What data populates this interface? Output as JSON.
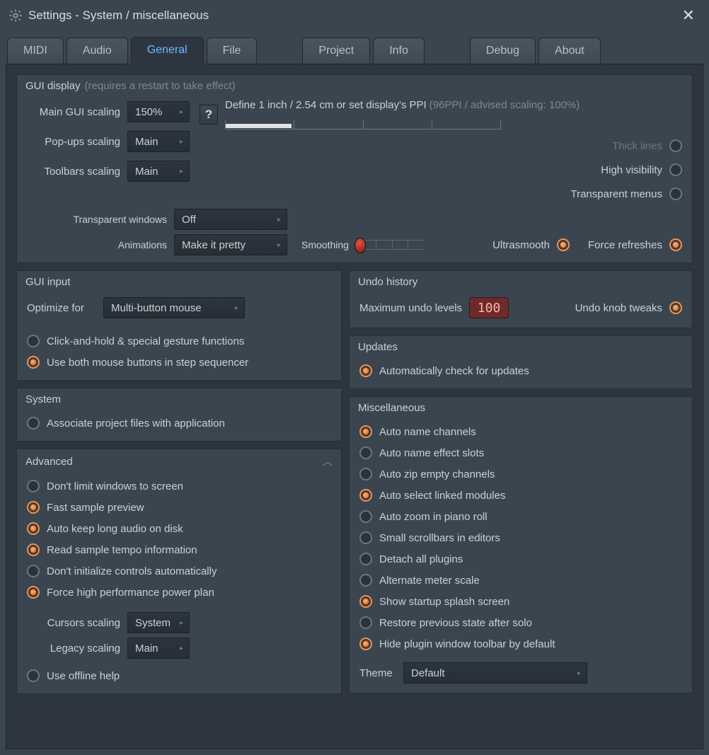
{
  "window": {
    "title": "Settings - System / miscellaneous"
  },
  "tabs": [
    "MIDI",
    "Audio",
    "General",
    "File",
    "Project",
    "Info",
    "Debug",
    "About"
  ],
  "active_tab": "General",
  "gui_display": {
    "title": "GUI display",
    "hint": "(requires a restart to take effect)",
    "main_scaling_label": "Main GUI scaling",
    "main_scaling_value": "150%",
    "popups_scaling_label": "Pop-ups scaling",
    "popups_scaling_value": "Main",
    "toolbars_scaling_label": "Toolbars scaling",
    "toolbars_scaling_value": "Main",
    "ppi_label": "Define 1 inch / 2.54 cm or set display's PPI",
    "ppi_hint": "(96PPI / advised scaling: 100%)",
    "opts": {
      "thick_lines": "Thick lines",
      "high_visibility": "High visibility",
      "transparent_menus": "Transparent menus",
      "force_refreshes": "Force refreshes"
    },
    "transparent_windows_label": "Transparent windows",
    "transparent_windows_value": "Off",
    "animations_label": "Animations",
    "animations_value": "Make it pretty",
    "smoothing_label": "Smoothing",
    "ultrasmooth_label": "Ultrasmooth"
  },
  "gui_input": {
    "title": "GUI input",
    "optimize_label": "Optimize for",
    "optimize_value": "Multi-button mouse",
    "click_hold": "Click-and-hold & special gesture functions",
    "both_buttons": "Use both mouse buttons in step sequencer"
  },
  "system": {
    "title": "System",
    "associate": "Associate project files with application"
  },
  "advanced": {
    "title": "Advanced",
    "items": [
      {
        "label": "Don't limit windows to screen",
        "on": false
      },
      {
        "label": "Fast sample preview",
        "on": true
      },
      {
        "label": "Auto keep long audio on disk",
        "on": true
      },
      {
        "label": "Read sample tempo information",
        "on": true
      },
      {
        "label": "Don't initialize controls automatically",
        "on": false
      },
      {
        "label": "Force high performance power plan",
        "on": true
      }
    ],
    "cursors_scaling_label": "Cursors scaling",
    "cursors_scaling_value": "System",
    "legacy_scaling_label": "Legacy scaling",
    "legacy_scaling_value": "Main",
    "offline_help": "Use offline help"
  },
  "undo": {
    "title": "Undo history",
    "max_label": "Maximum undo levels",
    "max_value": "100",
    "knob_tweaks": "Undo knob tweaks"
  },
  "updates": {
    "title": "Updates",
    "auto_check": "Automatically check for updates"
  },
  "misc": {
    "title": "Miscellaneous",
    "items": [
      {
        "label": "Auto name channels",
        "on": true
      },
      {
        "label": "Auto name effect slots",
        "on": false
      },
      {
        "label": "Auto zip empty channels",
        "on": false
      },
      {
        "label": "Auto select linked modules",
        "on": true
      },
      {
        "label": "Auto zoom in piano roll",
        "on": false
      },
      {
        "label": "Small scrollbars in editors",
        "on": false
      },
      {
        "label": "Detach all plugins",
        "on": false
      },
      {
        "label": "Alternate meter scale",
        "on": false
      },
      {
        "label": "Show startup splash screen",
        "on": true
      },
      {
        "label": "Restore previous state after solo",
        "on": false
      },
      {
        "label": "Hide plugin window toolbar by default",
        "on": true
      }
    ],
    "theme_label": "Theme",
    "theme_value": "Default"
  }
}
